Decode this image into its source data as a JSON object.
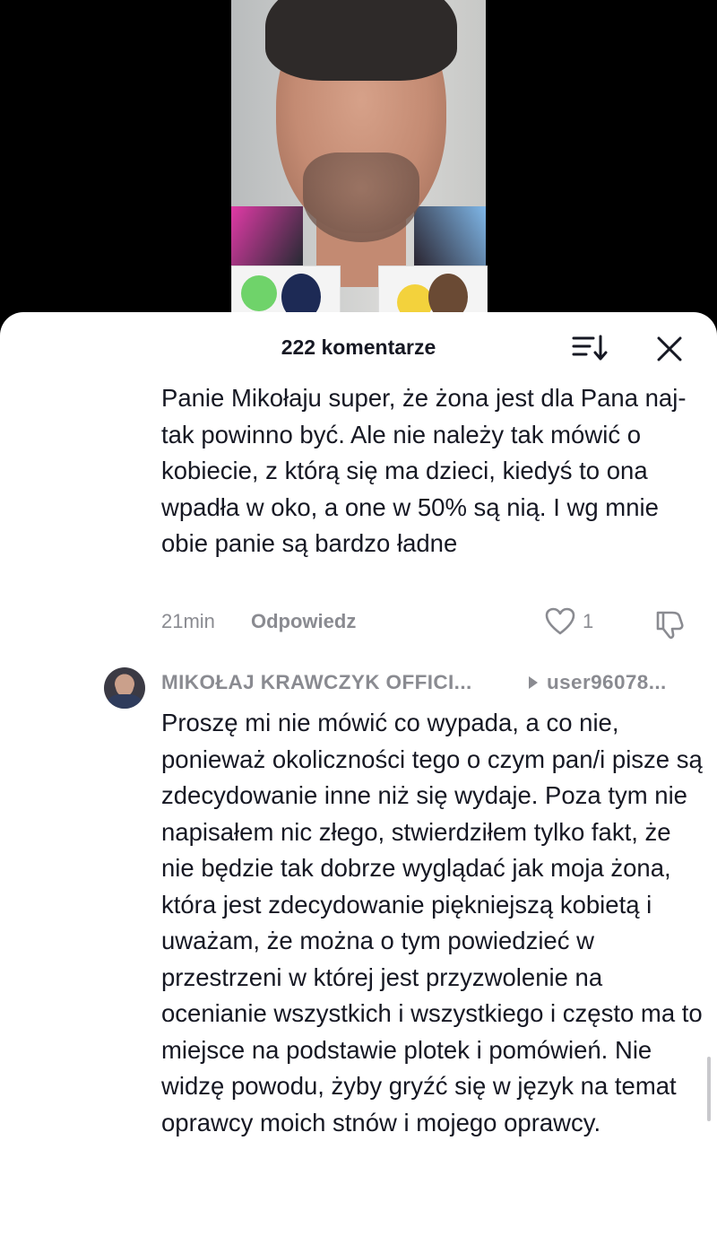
{
  "header": {
    "comment_count": "222 komentarze"
  },
  "comments": [
    {
      "text": "Panie Mikołaju super, że żona jest dla Pana naj- tak powinno być. Ale nie należy tak mówić o kobiecie, z którą się ma dzieci, kiedyś to ona wpadła w oko, a one w 50% są nią. I wg mnie obie panie są bardzo ładne",
      "time": "21min",
      "reply_label": "Odpowiedz",
      "likes": "1"
    },
    {
      "author": "MIKOŁAJ KRAWCZYK OFFICI...",
      "reply_to": "user96078...",
      "text": "Proszę mi nie mówić co wypada, a co nie, ponieważ okoliczności tego o czym pan/i pisze są zdecydowanie inne niż się wydaje. Poza tym nie napisałem nic złego, stwierdziłem tylko fakt, że nie będzie tak dobrze wyglądać jak moja żona, która jest zdecydowanie piękniejszą kobietą i uważam, że można o tym powiedzieć w przestrzeni w której jest przyzwolenie na ocenianie wszystkich i wszystkiego i często ma to miejsce na podstawie plotek i pomówień. Nie widzę powodu, żyby gryźć się w język na temat oprawcy moich stnów i mojego oprawcy."
    }
  ],
  "icons": [
    "sort-icon",
    "close-icon",
    "heart-icon",
    "dislike-icon",
    "caret-right-icon"
  ],
  "colors": {
    "text_primary": "#161823",
    "text_secondary": "#8a8b91",
    "sheet_background": "#ffffff",
    "backdrop": "#000000"
  }
}
